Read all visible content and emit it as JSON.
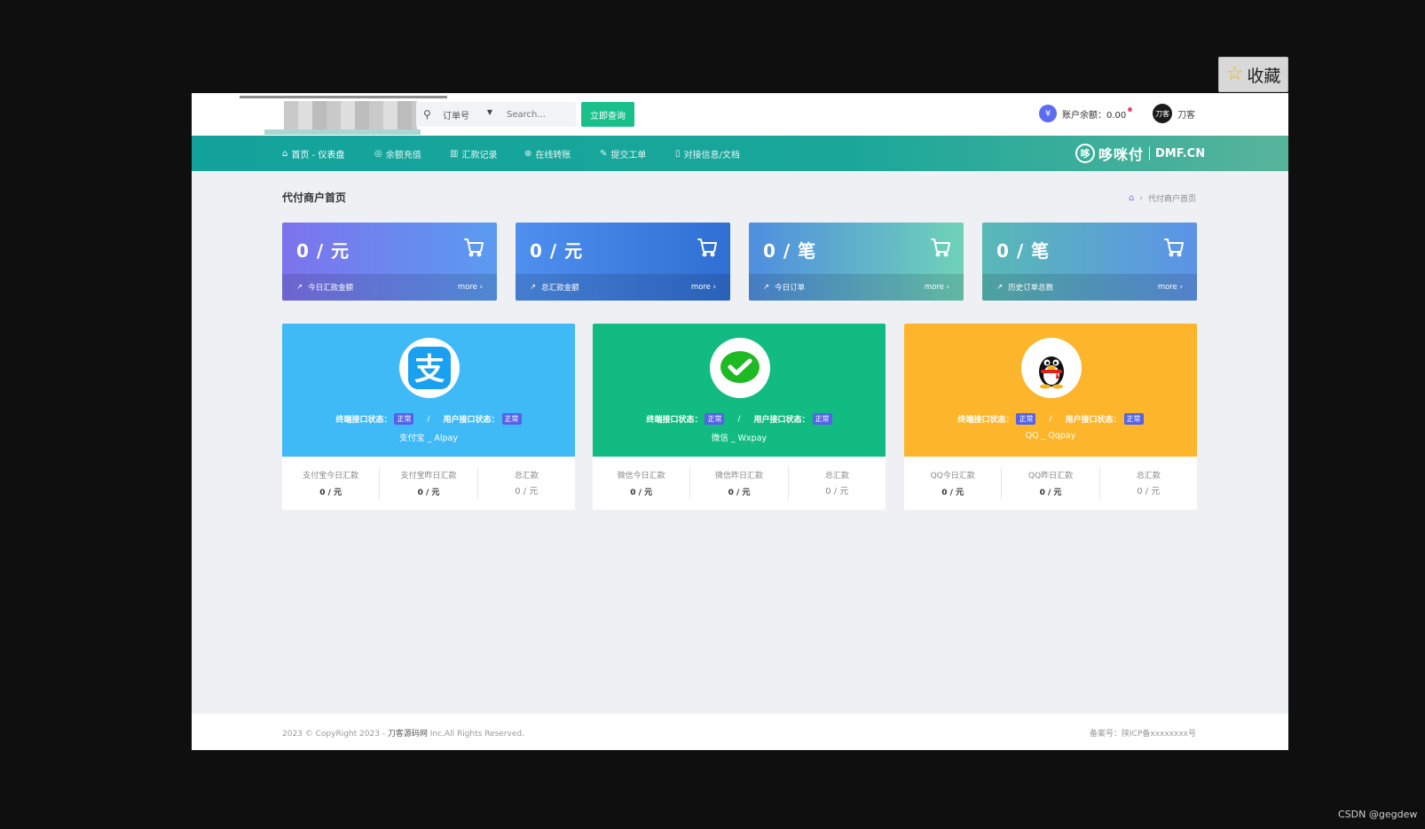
{
  "favorite": {
    "label": "收藏"
  },
  "header": {
    "search_select": "订单号",
    "search_placeholder": "Search...",
    "query_button": "立即查询",
    "balance_icon": "¥",
    "balance_text": "账户余额：0.00",
    "user_avatar": "刀客",
    "user_name": "刀客"
  },
  "nav": {
    "items": [
      {
        "label": "首页 - 仪表盘",
        "icon": "home-icon"
      },
      {
        "label": "余额充值",
        "icon": "coin-icon"
      },
      {
        "label": "汇款记录",
        "icon": "bar-chart-icon"
      },
      {
        "label": "在线转账",
        "icon": "globe-icon"
      },
      {
        "label": "提交工单",
        "icon": "edit-icon"
      },
      {
        "label": "对接信息/文档",
        "icon": "doc-icon"
      }
    ],
    "brand_icon": "哆",
    "brand_name": "哆咪付",
    "brand_domain": "DMF.CN"
  },
  "page": {
    "title": "代付商户首页",
    "breadcrumb_current": "代付商户首页"
  },
  "stats": [
    {
      "value": "0 / 元",
      "label": "今日汇款金额",
      "more": "more"
    },
    {
      "value": "0 / 元",
      "label": "总汇款金额",
      "more": "more"
    },
    {
      "value": "0 / 笔",
      "label": "今日订单",
      "more": "more"
    },
    {
      "value": "0 / 笔",
      "label": "历史订单总数",
      "more": "more"
    }
  ],
  "channels": [
    {
      "icon": "alipay-icon",
      "terminal_label": "终端接口状态：",
      "terminal_status": "正常",
      "user_label": "用户接口状态：",
      "user_status": "正常",
      "name": "支付宝 _ Alpay",
      "today_label": "支付宝今日汇款",
      "today_value": "0 / 元",
      "yesterday_label": "支付宝昨日汇款",
      "yesterday_value": "0 / 元",
      "total_label": "总汇款",
      "total_value": "0 / 元"
    },
    {
      "icon": "wechat-icon",
      "terminal_label": "终端接口状态：",
      "terminal_status": "正常",
      "user_label": "用户接口状态：",
      "user_status": "正常",
      "name": "微信 _ Wxpay",
      "today_label": "微信今日汇款",
      "today_value": "0 / 元",
      "yesterday_label": "微信昨日汇款",
      "yesterday_value": "0 / 元",
      "total_label": "总汇款",
      "total_value": "0 / 元"
    },
    {
      "icon": "qq-icon",
      "terminal_label": "终端接口状态：",
      "terminal_status": "正常",
      "user_label": "用户接口状态：",
      "user_status": "正常",
      "name": "QQ _ Qqpay",
      "today_label": "QQ今日汇款",
      "today_value": "0 / 元",
      "yesterday_label": "QQ昨日汇款",
      "yesterday_value": "0 / 元",
      "total_label": "总汇款",
      "total_value": "0 / 元"
    }
  ],
  "footer": {
    "copyright_prefix": "2023 © CopyRight 2023 - ",
    "site": "刀客源码网",
    "copyright_suffix": " Inc.All Rights Reserved.",
    "icp": "备案号：陕ICP备xxxxxxxx号"
  },
  "watermark": "CSDN @gegdew"
}
